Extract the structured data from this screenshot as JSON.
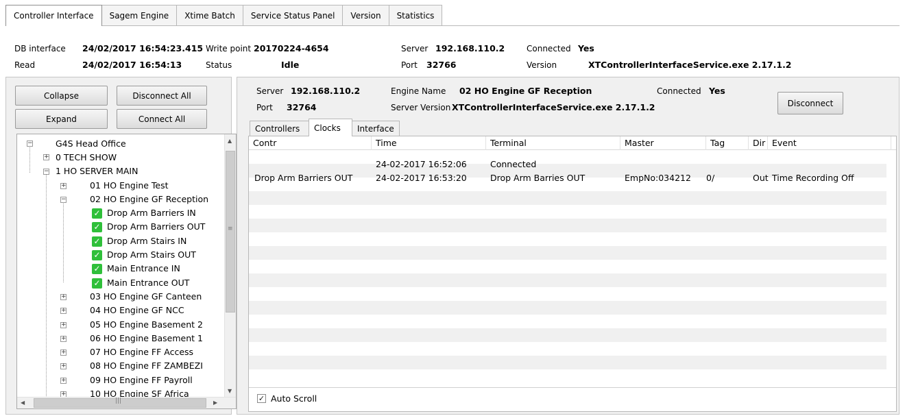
{
  "top_tabs": [
    "Controller Interface",
    "Sagem Engine",
    "Xtime Batch",
    "Service Status Panel",
    "Version",
    "Statistics"
  ],
  "status": {
    "db_interface_label": "DB interface",
    "db_interface_value": "24/02/2017 16:54:23.415",
    "read_label": "Read",
    "read_value": "24/02/2017 16:54:13",
    "write_point_label": "Write point",
    "write_point_value": "20170224-4654",
    "status_label": "Status",
    "status_value": "Idle",
    "server_label": "Server",
    "server_value": "192.168.110.2",
    "port_label": "Port",
    "port_value": "32766",
    "connected_label": "Connected",
    "connected_value": "Yes",
    "version_label": "Version",
    "version_value": "XTControllerInterfaceService.exe 2.17.1.2"
  },
  "left_buttons": {
    "collapse": "Collapse",
    "disconnect_all": "Disconnect All",
    "expand": "Expand",
    "connect_all": "Connect All"
  },
  "tree": {
    "root": "G4S Head Office",
    "nodes": [
      {
        "label": "0 TECH SHOW"
      },
      {
        "label": "1 HO SERVER MAIN"
      },
      {
        "label": "01 HO Engine Test"
      },
      {
        "label": "02 HO Engine GF Reception"
      },
      {
        "label": "Drop Arm Barriers IN"
      },
      {
        "label": "Drop Arm Barriers OUT"
      },
      {
        "label": "Drop Arm Stairs IN"
      },
      {
        "label": "Drop Arm Stairs OUT"
      },
      {
        "label": "Main Entrance IN"
      },
      {
        "label": "Main Entrance OUT"
      },
      {
        "label": "03 HO Engine GF Canteen"
      },
      {
        "label": "04 HO Engine GF NCC"
      },
      {
        "label": "05 HO Engine Basement 2"
      },
      {
        "label": "06 HO Engine Basement 1"
      },
      {
        "label": "07 HO Engine FF Access"
      },
      {
        "label": "08 HO Engine FF ZAMBEZI"
      },
      {
        "label": "09 HO Engine FF Payroll"
      },
      {
        "label": "10 HO Engine SF Africa"
      }
    ]
  },
  "engine": {
    "server_label": "Server",
    "server_value": "192.168.110.2",
    "port_label": "Port",
    "port_value": "32764",
    "engine_name_label": "Engine Name",
    "engine_name_value": "02 HO Engine GF Reception",
    "server_version_label": "Server Version",
    "server_version_value": "XTControllerInterfaceService.exe 2.17.1.2",
    "connected_label": "Connected",
    "connected_value": "Yes",
    "disconnect_button": "Disconnect"
  },
  "sub_tabs": [
    "Controllers",
    "Clocks",
    "Interface"
  ],
  "grid": {
    "columns": [
      "Contr",
      "Time",
      "Terminal",
      "Master",
      "Tag",
      "Dir",
      "Event"
    ],
    "rows": [
      [
        "",
        "24-02-2017 16:52:06",
        "Connected",
        "",
        "",
        "",
        ""
      ],
      [
        "Drop Arm Barriers OUT",
        "24-02-2017 16:53:20",
        "Drop Arm Barries OUT",
        "EmpNo:034212",
        "0/",
        "Out",
        "Time Recording Off"
      ]
    ]
  },
  "auto_scroll": {
    "label": "Auto Scroll",
    "checked": true
  },
  "icons": {
    "checked": "green-check",
    "expander": "plus-box",
    "collapser": "minus-box"
  },
  "colors": {
    "check_green": "#2fbf3a",
    "alt_row": "#f0f0f0"
  }
}
